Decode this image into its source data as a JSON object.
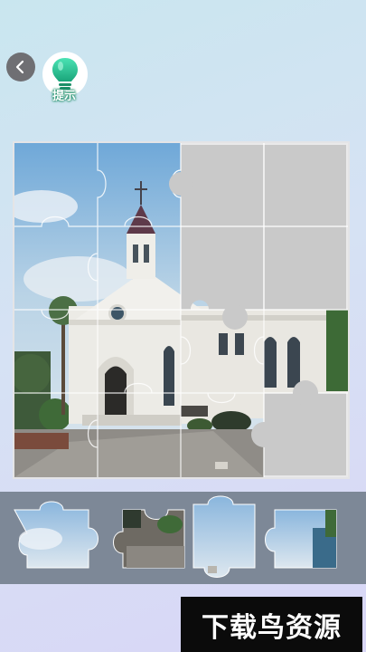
{
  "header": {
    "back_icon": "chevron-left-icon",
    "hint_icon": "lightbulb-icon",
    "hint_label": "提示"
  },
  "puzzle": {
    "grid": "4x4",
    "filled_slots": 11,
    "empty_slots": 5
  },
  "tray": {
    "pieces": [
      {
        "name": "sky-piece"
      },
      {
        "name": "street-piece"
      },
      {
        "name": "sky-corner-piece"
      },
      {
        "name": "building-edge-piece"
      }
    ]
  },
  "watermark": {
    "text": "下载鸟资源"
  },
  "colors": {
    "board_empty": "#c9c9c9",
    "tray_bg": "#7d8897",
    "hint_green": "#2fbf8f"
  }
}
